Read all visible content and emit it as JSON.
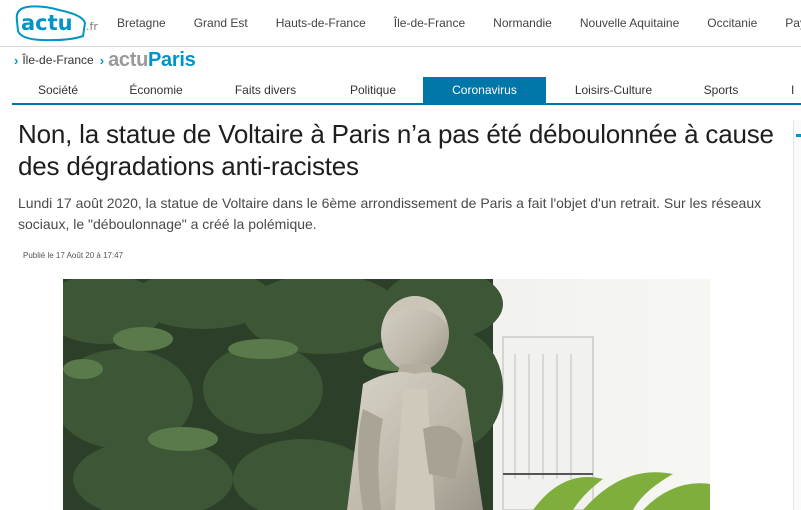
{
  "logo": {
    "main": "actu",
    "suffix": ".fr"
  },
  "regions": [
    "Bretagne",
    "Grand Est",
    "Hauts-de-France",
    "Île-de-France",
    "Normandie",
    "Nouvelle Aquitaine",
    "Occitanie",
    "Pays de"
  ],
  "breadcrumb": {
    "region": "Île-de-France",
    "brand_prefix": "actu",
    "brand_city": "Paris"
  },
  "categories": [
    {
      "label": "Société",
      "active": false
    },
    {
      "label": "Économie",
      "active": false
    },
    {
      "label": "Faits divers",
      "active": false
    },
    {
      "label": "Politique",
      "active": false
    },
    {
      "label": "Coronavirus",
      "active": true
    },
    {
      "label": "Loisirs-Culture",
      "active": false
    },
    {
      "label": "Sports",
      "active": false
    },
    {
      "label": "I",
      "active": false
    }
  ],
  "article": {
    "title": "Non, la statue de Voltaire à Paris n’a pas été déboulonnée à cause des dégradations anti-racistes",
    "lead": "Lundi 17 août 2020, la statue de Voltaire dans le 6ème arrondissement de Paris a fait l'objet d'un retrait. Sur les réseaux sociaux, le \"déboulonnage\" a créé la polémique.",
    "published": "Publié le 17 Août 20 à 17:47"
  },
  "colors": {
    "brand_blue": "#0095c8",
    "nav_active": "#0077a8",
    "brand_grey": "#9a9a9a"
  },
  "hero_image": {
    "subject": "statue-photo"
  }
}
